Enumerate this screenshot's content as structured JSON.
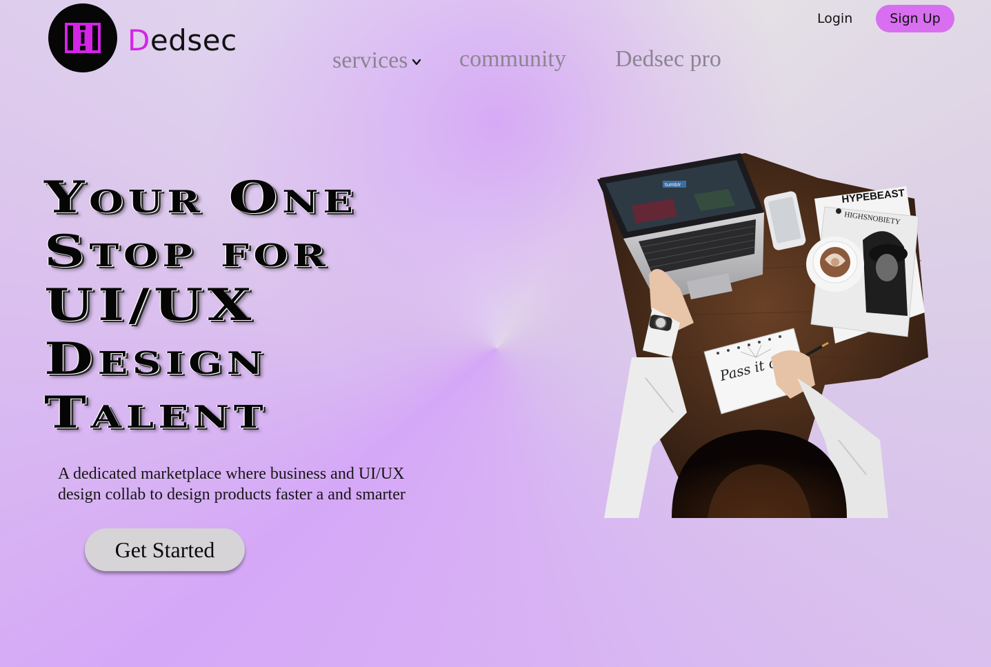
{
  "header": {
    "logo_icon": "dedsec-logo-icon",
    "brand_first_letter": "D",
    "brand_rest": "edsec",
    "nav": [
      {
        "label": "services",
        "has_dropdown": true,
        "dropdown_icon": "chevron-down-icon"
      },
      {
        "label": "community"
      },
      {
        "label": "Dedsec pro"
      }
    ],
    "login_label": "Login",
    "signup_label": "Sign Up"
  },
  "hero": {
    "title_lines": [
      "Your One",
      "Stop for",
      "UI/UX",
      "Design",
      "Talent"
    ],
    "description": "A dedicated marketplace where business and UI/UX design collab to design products faster a and smarter",
    "cta_label": "Get Started",
    "image_texts": {
      "magazine_1": "HYPEBEAST",
      "magazine_2": "HIGHSNOBIETY",
      "sketch": "Pass it on",
      "laptop_screen": "tumblr"
    }
  },
  "colors": {
    "accent": "#d424e6",
    "signup_bg": "#d86ef0",
    "cta_bg": "#d6d4d6",
    "nav_text": "#8a8592"
  }
}
